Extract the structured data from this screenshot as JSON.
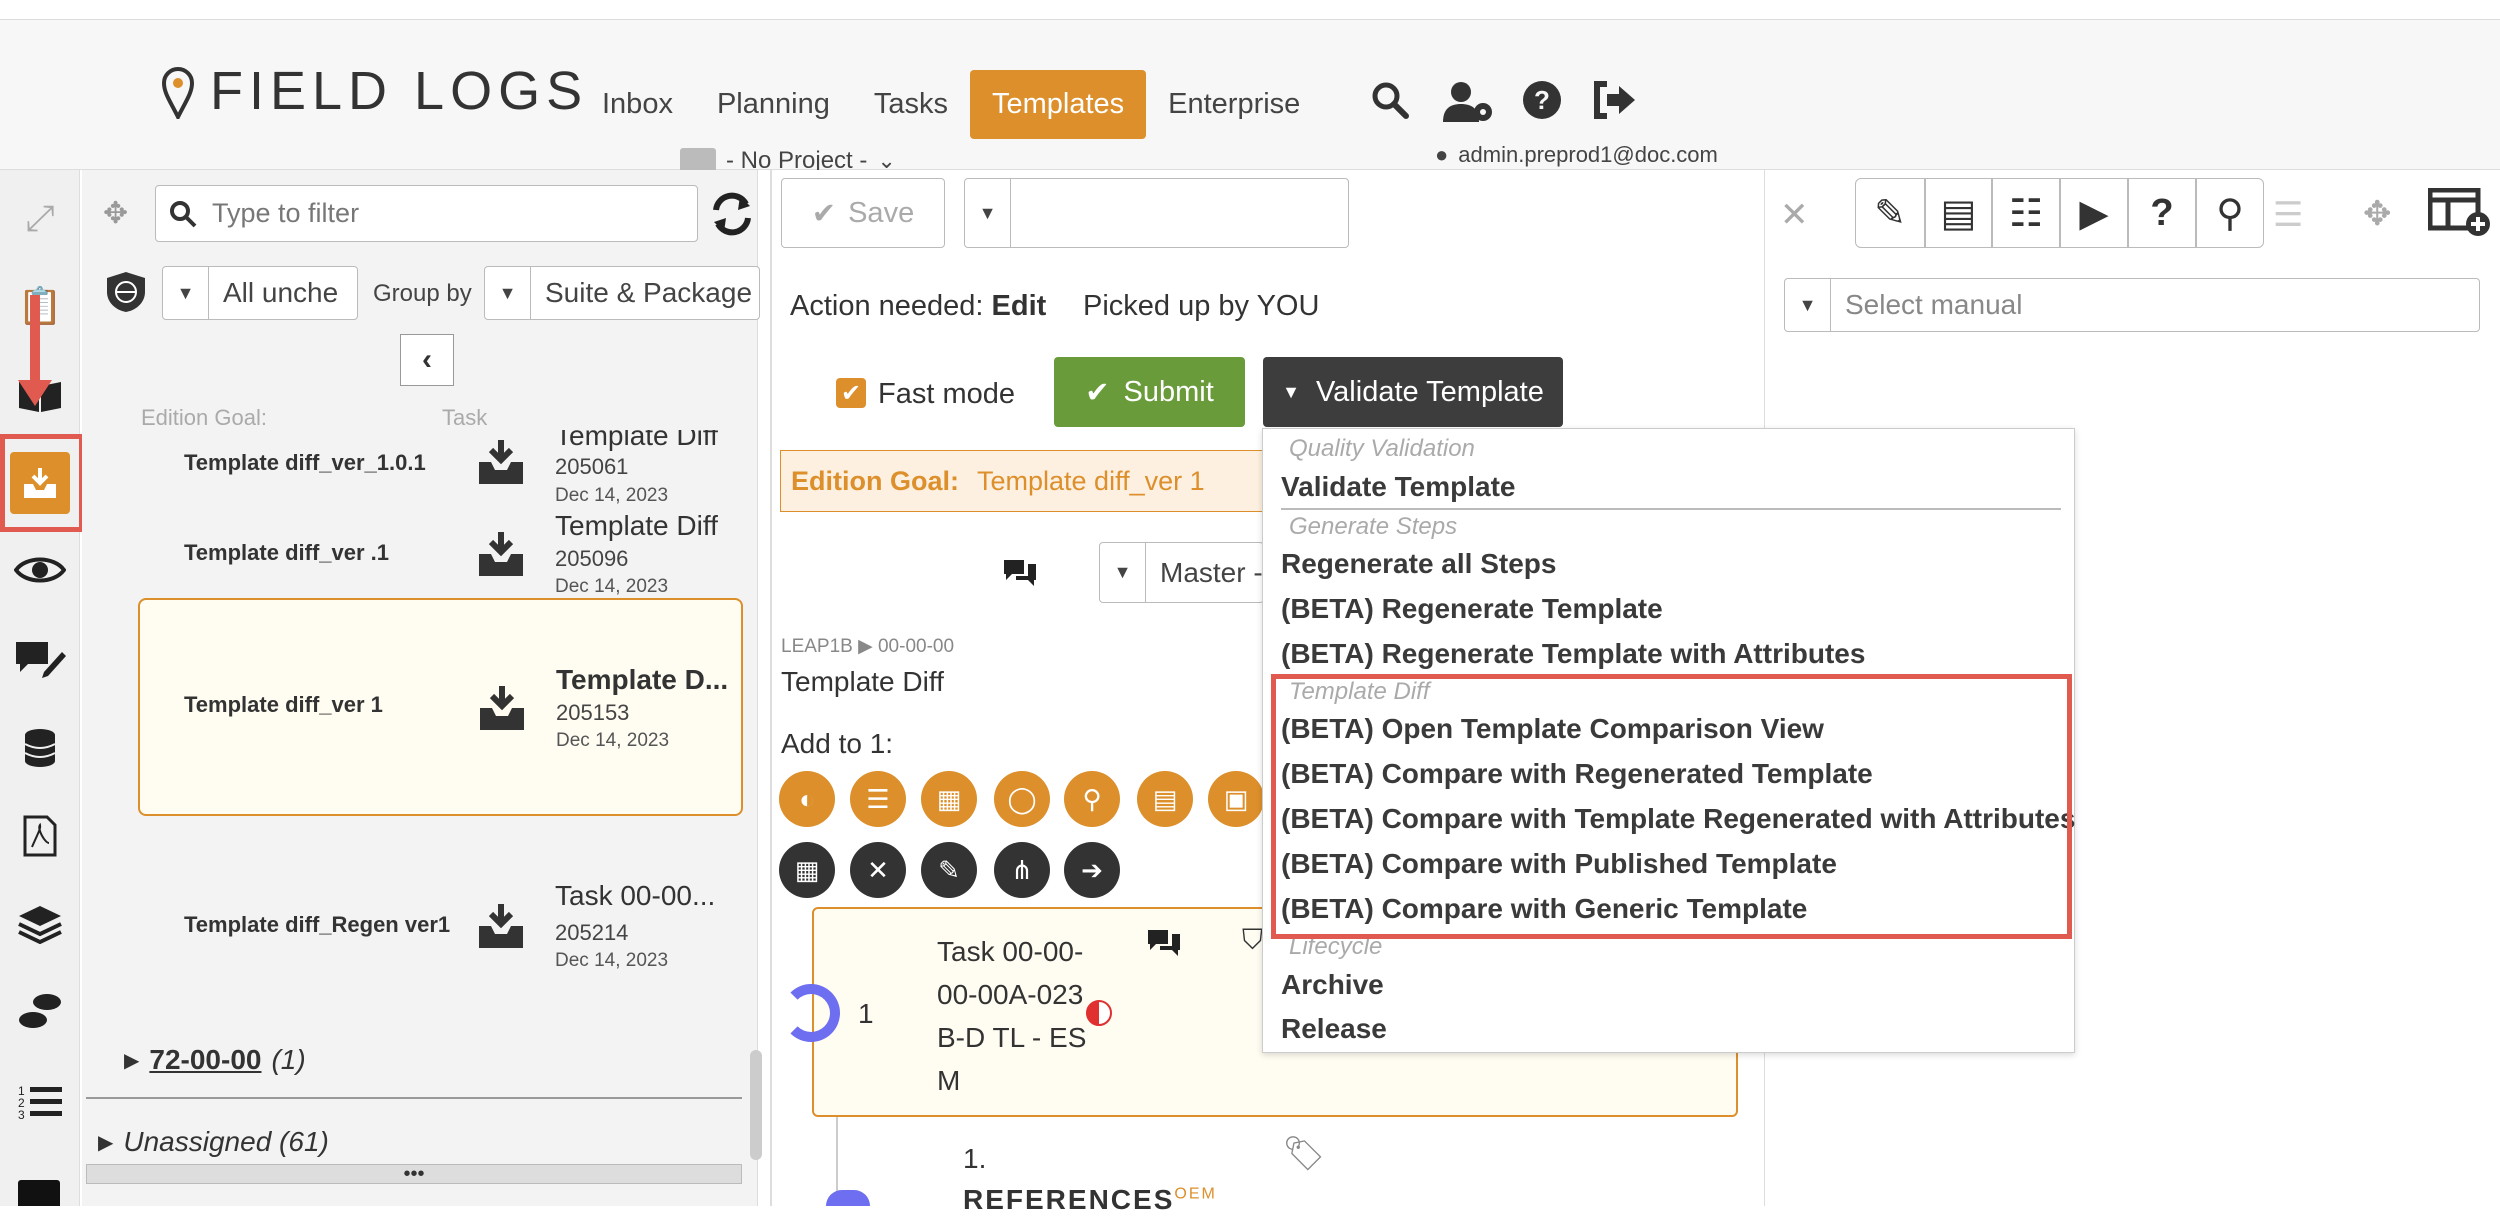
{
  "app": {
    "logo": "FIELD LOGS"
  },
  "nav": {
    "items": [
      "Inbox",
      "Planning",
      "Tasks",
      "Templates",
      "Enterprise"
    ],
    "active": "Templates"
  },
  "header": {
    "project": "- No Project -",
    "user": "admin.preprod1@doc.com"
  },
  "filter": {
    "placeholder": "Type to filter",
    "status_select": "All unche",
    "group_by_label": "Group by",
    "group_by_select": "Suite & Package"
  },
  "list": {
    "col_edition_goal": "Edition Goal:",
    "col_task": "Task",
    "rows": [
      {
        "name": "Template diff_ver_1.0.1",
        "title": "Template Diff",
        "num": "205061",
        "date": "Dec 14, 2023"
      },
      {
        "name": "Template diff_ver .1",
        "title": "Template Diff",
        "num": "205096",
        "date": "Dec 14, 2023"
      },
      {
        "name": "Template diff_ver 1",
        "title": "Template D...",
        "num": "205153",
        "date": "Dec 14, 2023"
      },
      {
        "name": "Template diff_Regen ver1",
        "title": "Task 00-00...",
        "num": "205214",
        "date": "Dec 14, 2023"
      }
    ],
    "group_72": "72-00-00",
    "group_72_count": "(1)",
    "unassigned": "Unassigned (61)"
  },
  "editor": {
    "save_label": "Save",
    "action_needed_label": "Action needed:",
    "action_needed_value": "Edit",
    "picked_up": "Picked up by YOU",
    "fast_mode": "Fast mode",
    "submit": "Submit",
    "validate": "Validate Template",
    "edition_goal_label": "Edition Goal:",
    "edition_goal_value": "Template diff_ver 1",
    "master_select": "Master -",
    "breadcrumb": "LEAP1B ▶ 00-00-00",
    "doc_title": "Template Diff",
    "add_to": "Add to 1:",
    "step_number": "1",
    "step_title": "Task 00-00-00-00A-023B-D TL - ESM",
    "sub_number": "1.",
    "sub_title": "REFERENCES",
    "sub_tag": "OEM"
  },
  "menu": {
    "h_quality": "Quality Validation",
    "validate_template": "Validate Template",
    "h_generate": "Generate Steps",
    "regen_all": "Regenerate all Steps",
    "beta_regen": "(BETA) Regenerate Template",
    "beta_regen_attr": "(BETA) Regenerate Template with Attributes",
    "h_diff": "Template Diff",
    "open_compare": "(BETA) Open Template Comparison View",
    "cmp_regen": "(BETA) Compare with Regenerated Template",
    "cmp_regen_attr": "(BETA) Compare with Template Regenerated with Attributes",
    "cmp_published": "(BETA) Compare with Published Template",
    "cmp_generic": "(BETA) Compare with Generic Template",
    "h_lifecycle": "Lifecycle",
    "archive": "Archive",
    "release": "Release"
  },
  "right": {
    "manual_placeholder": "Select manual"
  },
  "colors": {
    "accent": "#dc8f2b",
    "submit": "#6a9b3a",
    "dark": "#3d3d3d",
    "highlight_red": "#e05a4f"
  }
}
